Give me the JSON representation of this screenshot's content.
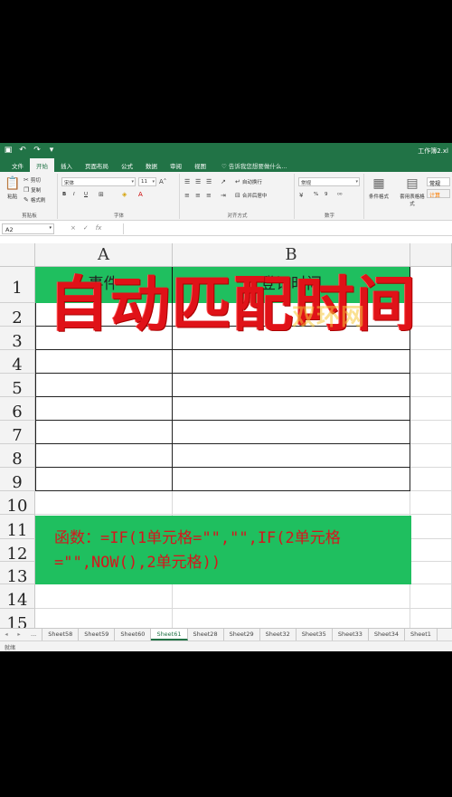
{
  "titlebar": {
    "window_title": "工作簿2.xl"
  },
  "tabs": {
    "items": [
      "文件",
      "开始",
      "插入",
      "页面布局",
      "公式",
      "数据",
      "审阅",
      "视图"
    ],
    "active": 1,
    "tell_me": "告诉我您想要做什么..."
  },
  "ribbon": {
    "clipboard": {
      "paste": "粘贴",
      "cut": "剪切",
      "copy": "复制",
      "format_painter": "格式刷",
      "label": "剪贴板"
    },
    "font": {
      "name": "宋体",
      "size": "11",
      "bold": "B",
      "italic": "I",
      "underline": "U",
      "label": "字体"
    },
    "alignment": {
      "wrap": "自动换行",
      "merge": "合并后居中",
      "label": "对齐方式"
    },
    "number": {
      "format": "常规",
      "percent": "%",
      "comma": "9",
      "label": "数字"
    },
    "styles": {
      "conditional": "条件格式",
      "table": "套用表格格式",
      "normal": "常规",
      "calc": "计算"
    }
  },
  "formula_bar": {
    "name_box": "A2",
    "cancel": "×",
    "enter": "✓",
    "fx": "fx"
  },
  "columns": [
    "A",
    "B"
  ],
  "rows": [
    "1",
    "2",
    "3",
    "4",
    "5",
    "6",
    "7",
    "8",
    "9",
    "10",
    "11",
    "12",
    "13",
    "14",
    "15"
  ],
  "table": {
    "headers": [
      "事件",
      "登记时间"
    ]
  },
  "overlay_title": "自动匹配时间",
  "watermark": "双环网",
  "formula": {
    "line1": "函数：=IF(1单元格=\"\",\"\",IF(2单元格",
    "line2": "=\"\",NOW(),2单元格))"
  },
  "sheet_tabs": {
    "more": "...",
    "items": [
      "Sheet58",
      "Sheet59",
      "Sheet60",
      "Sheet61",
      "Sheet28",
      "Sheet29",
      "Sheet32",
      "Sheet35",
      "Sheet33",
      "Sheet34",
      "Sheet1"
    ],
    "active": 3
  },
  "status": {
    "text": "就绪"
  },
  "colors": {
    "excel_green": "#217346",
    "header_green": "#1fbf5f",
    "title_red": "#e01218"
  }
}
